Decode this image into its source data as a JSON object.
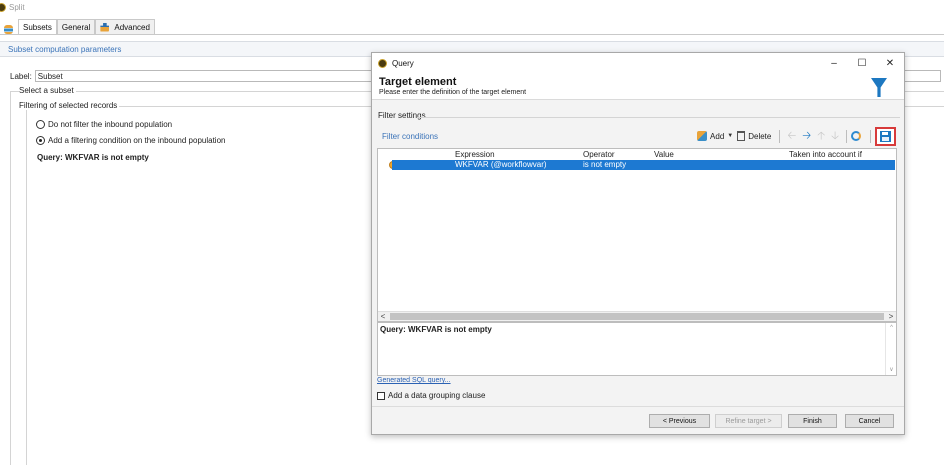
{
  "window": {
    "title": "Split"
  },
  "tabs": [
    {
      "label": "Subsets"
    },
    {
      "label": "General"
    },
    {
      "label": "Advanced"
    }
  ],
  "section": {
    "title": "Subset computation parameters"
  },
  "label_field": {
    "label": "Label:",
    "value": "Subset"
  },
  "select_subset": {
    "legend": "Select a subset"
  },
  "filtering": {
    "legend": "Filtering of selected records",
    "option1": "Do not filter the inbound population",
    "option2": "Add a filtering condition on the inbound population",
    "query": "Query: WKFVAR is not empty"
  },
  "dialog": {
    "title": "Query",
    "heading": "Target element",
    "subheading": "Please enter the definition of the target element",
    "filter_settings_legend": "Filter settings",
    "filter_conditions_title": "Filter conditions",
    "toolbar": {
      "add_label": "Add",
      "delete_label": "Delete"
    },
    "grid": {
      "columns": [
        "Expression",
        "Operator",
        "Value",
        "Taken into account if"
      ],
      "rows": [
        {
          "expression": "WKFVAR (@workflowvar)",
          "operator": "is not empty",
          "value": "",
          "condition": ""
        }
      ]
    },
    "query_text": "Query: WKFVAR is not empty",
    "sql_link": "Generated SQL query...",
    "grouping_label": "Add a data grouping clause",
    "buttons": {
      "previous": "< Previous",
      "refine": "Refine target >",
      "finish": "Finish",
      "cancel": "Cancel"
    }
  },
  "colors": {
    "accent": "#1d78c1",
    "link": "#3a73b8",
    "highlight_border": "#d73a3a",
    "selected_row": "#1d79d2"
  }
}
